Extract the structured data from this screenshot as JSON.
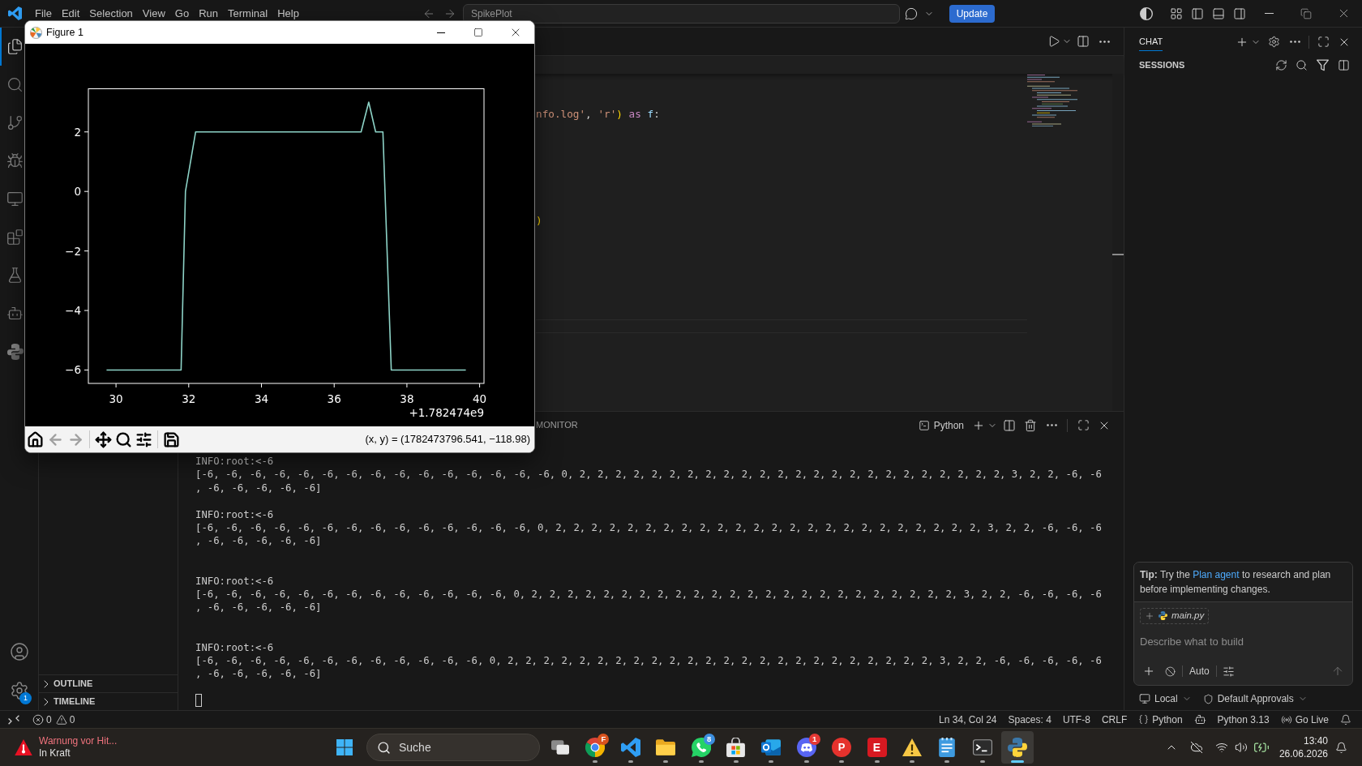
{
  "title_bar": {
    "menu": [
      "File",
      "Edit",
      "Selection",
      "View",
      "Go",
      "Run",
      "Terminal",
      "Help"
    ],
    "command_center": "SpikePlot",
    "update_button": "Update"
  },
  "activity_bar": {
    "items": [
      {
        "kind": "explorer",
        "selected": true
      },
      {
        "kind": "search",
        "selected": false
      },
      {
        "kind": "source-control",
        "selected": false
      },
      {
        "kind": "run-debug",
        "selected": false
      },
      {
        "kind": "remote",
        "selected": false
      },
      {
        "kind": "extensions",
        "selected": false
      },
      {
        "kind": "testing",
        "selected": false
      },
      {
        "kind": "agent",
        "selected": false
      },
      {
        "kind": "python",
        "selected": false
      }
    ],
    "settings_badge": "1"
  },
  "figure": {
    "title": "Figure 1",
    "chart_data": {
      "type": "line",
      "x": [
        29.74,
        31.79,
        31.91,
        32.19,
        36.74,
        36.95,
        37.14,
        37.34,
        37.57,
        39.62
      ],
      "values": [
        -6,
        -6,
        0,
        2,
        2,
        3,
        2,
        2,
        -6,
        -6
      ],
      "xlim": [
        29.24,
        40.12
      ],
      "ylim": [
        -6.45,
        3.45
      ],
      "xticks": [
        30,
        32,
        34,
        36,
        38,
        40
      ],
      "yticks": [
        {
          "value": -6,
          "label": "−6"
        },
        {
          "value": -4,
          "label": "−4"
        },
        {
          "value": -2,
          "label": "−2"
        },
        0,
        2
      ]
    },
    "x_offset_label": "+1.782474e9",
    "tools": [
      {
        "kind": "home",
        "disabled": false
      },
      {
        "kind": "back",
        "disabled": true
      },
      {
        "kind": "forward",
        "disabled": true
      },
      {
        "kind": "pan",
        "disabled": false
      },
      {
        "kind": "zoom",
        "disabled": false
      },
      {
        "kind": "subplots",
        "disabled": false
      },
      {
        "kind": "save",
        "disabled": false
      }
    ],
    "cursor_readout": "(x, y) = (1782473796.541, −118.98)"
  },
  "sidebar": {
    "sections": [
      {
        "label": "OUTLINE",
        "expanded": false
      },
      {
        "label": "TIMELINE",
        "expanded": false
      }
    ]
  },
  "editor": {
    "code_lines": [
      {
        "tokens": [
          {
            "text": "nfo.log'",
            "kind": "string"
          },
          {
            "text": ", ",
            "kind": "plain"
          },
          {
            "text": "'r'",
            "kind": "string"
          },
          {
            "text": ")",
            "kind": "bracket"
          },
          {
            "text": " as",
            "kind": "keyword"
          },
          {
            "text": " f",
            "kind": "variable"
          },
          {
            "text": ":",
            "kind": "plain"
          }
        ]
      },
      {
        "tokens": [
          {
            "text": ")",
            "kind": "bracket"
          }
        ]
      }
    ]
  },
  "panel": {
    "visible_tab": "MONITOR",
    "terminal": {
      "name": "Python",
      "output": [
        {
          "header": "INFO:root:<-6",
          "rows": [
            "[-6, -6, -6, -6, -6, -6, -6, -6, -6, -6, -6, -6, -6, -6, -6, 0, 2, 2, 2, 2, 2, 2, 2, 2, 2, 2, 2, 2, 2, 2, 2, 2, 2, 2, 2, 2, 2, 2, 2, 2, 3, 2, 2, -6, -6",
            ", -6, -6, -6, -6, -6]"
          ]
        },
        {
          "header": "INFO:root:<-6",
          "rows": [
            "[-6, -6, -6, -6, -6, -6, -6, -6, -6, -6, -6, -6, -6, -6, 0, 2, 2, 2, 2, 2, 2, 2, 2, 2, 2, 2, 2, 2, 2, 2, 2, 2, 2, 2, 2, 2, 2, 2, 2, 3, 2, 2, -6, -6, -6",
            ", -6, -6, -6, -6, -6]"
          ]
        },
        {
          "header": "INFO:root:<-6",
          "rows": [
            "[-6, -6, -6, -6, -6, -6, -6, -6, -6, -6, -6, -6, -6, 0, 2, 2, 2, 2, 2, 2, 2, 2, 2, 2, 2, 2, 2, 2, 2, 2, 2, 2, 2, 2, 2, 2, 2, 2, 3, 2, 2, -6, -6, -6, -6",
            ", -6, -6, -6, -6, -6]"
          ]
        },
        {
          "header": "INFO:root:<-6",
          "rows": [
            "[-6, -6, -6, -6, -6, -6, -6, -6, -6, -6, -6, -6, 0, 2, 2, 2, 2, 2, 2, 2, 2, 2, 2, 2, 2, 2, 2, 2, 2, 2, 2, 2, 2, 2, 2, 2, 2, 3, 2, 2, -6, -6, -6, -6, -6",
            ", -6, -6, -6, -6, -6]"
          ]
        }
      ]
    }
  },
  "chat": {
    "tab": {
      "label": "CHAT",
      "selected": true
    },
    "sessions_label": "SESSIONS",
    "tip": {
      "label": "Tip:",
      "before": "Try the",
      "link": "Plan agent",
      "after": "to research and plan before implementing changes."
    },
    "attachment": "main.py",
    "input": {
      "placeholder": "Describe what to build"
    },
    "mode": "Auto",
    "send": {
      "disabled": true
    },
    "location": "Local",
    "approvals": "Default Approvals"
  },
  "status_bar": {
    "problems": {
      "errors": "0",
      "warnings": "0"
    },
    "items": [
      {
        "kind": "text",
        "label": "Ln 34, Col 24"
      },
      {
        "kind": "text",
        "label": "Spaces: 4"
      },
      {
        "kind": "text",
        "label": "UTF-8"
      },
      {
        "kind": "text",
        "label": "CRLF"
      },
      {
        "kind": "language",
        "label": "Python"
      },
      {
        "kind": "copilot"
      },
      {
        "kind": "text",
        "label": "Python 3.13"
      },
      {
        "kind": "live",
        "label": "Go Live"
      },
      {
        "kind": "notifications"
      }
    ]
  },
  "taskbar": {
    "notification": {
      "title": "Warnung vor Hit...",
      "status": "In Kraft"
    },
    "search": {
      "label": "Suche"
    },
    "apps": [
      {
        "kind": "task-view",
        "running": false,
        "selected": false
      },
      {
        "kind": "browser",
        "badge": "F",
        "running": true,
        "selected": false
      },
      {
        "kind": "code-editor",
        "running": true,
        "selected": false
      },
      {
        "kind": "files",
        "running": true,
        "selected": false
      },
      {
        "kind": "messenger",
        "badge": "8",
        "running": true,
        "selected": false
      },
      {
        "kind": "store",
        "running": true,
        "selected": false
      },
      {
        "kind": "mail",
        "running": true,
        "selected": false
      },
      {
        "kind": "voice-chat",
        "badge": "1",
        "running": true,
        "selected": false
      },
      {
        "kind": "letter-round",
        "glyph": "P",
        "running": true,
        "selected": false
      },
      {
        "kind": "letter-square",
        "glyph": "E",
        "running": true,
        "selected": false
      },
      {
        "kind": "warning",
        "running": true,
        "selected": false
      },
      {
        "kind": "notes",
        "running": true,
        "selected": false
      },
      {
        "kind": "terminal",
        "running": true,
        "selected": false
      },
      {
        "kind": "python",
        "running": true,
        "selected": true
      }
    ],
    "clock": {
      "time": "13:40",
      "date": "26.06.2026"
    }
  }
}
